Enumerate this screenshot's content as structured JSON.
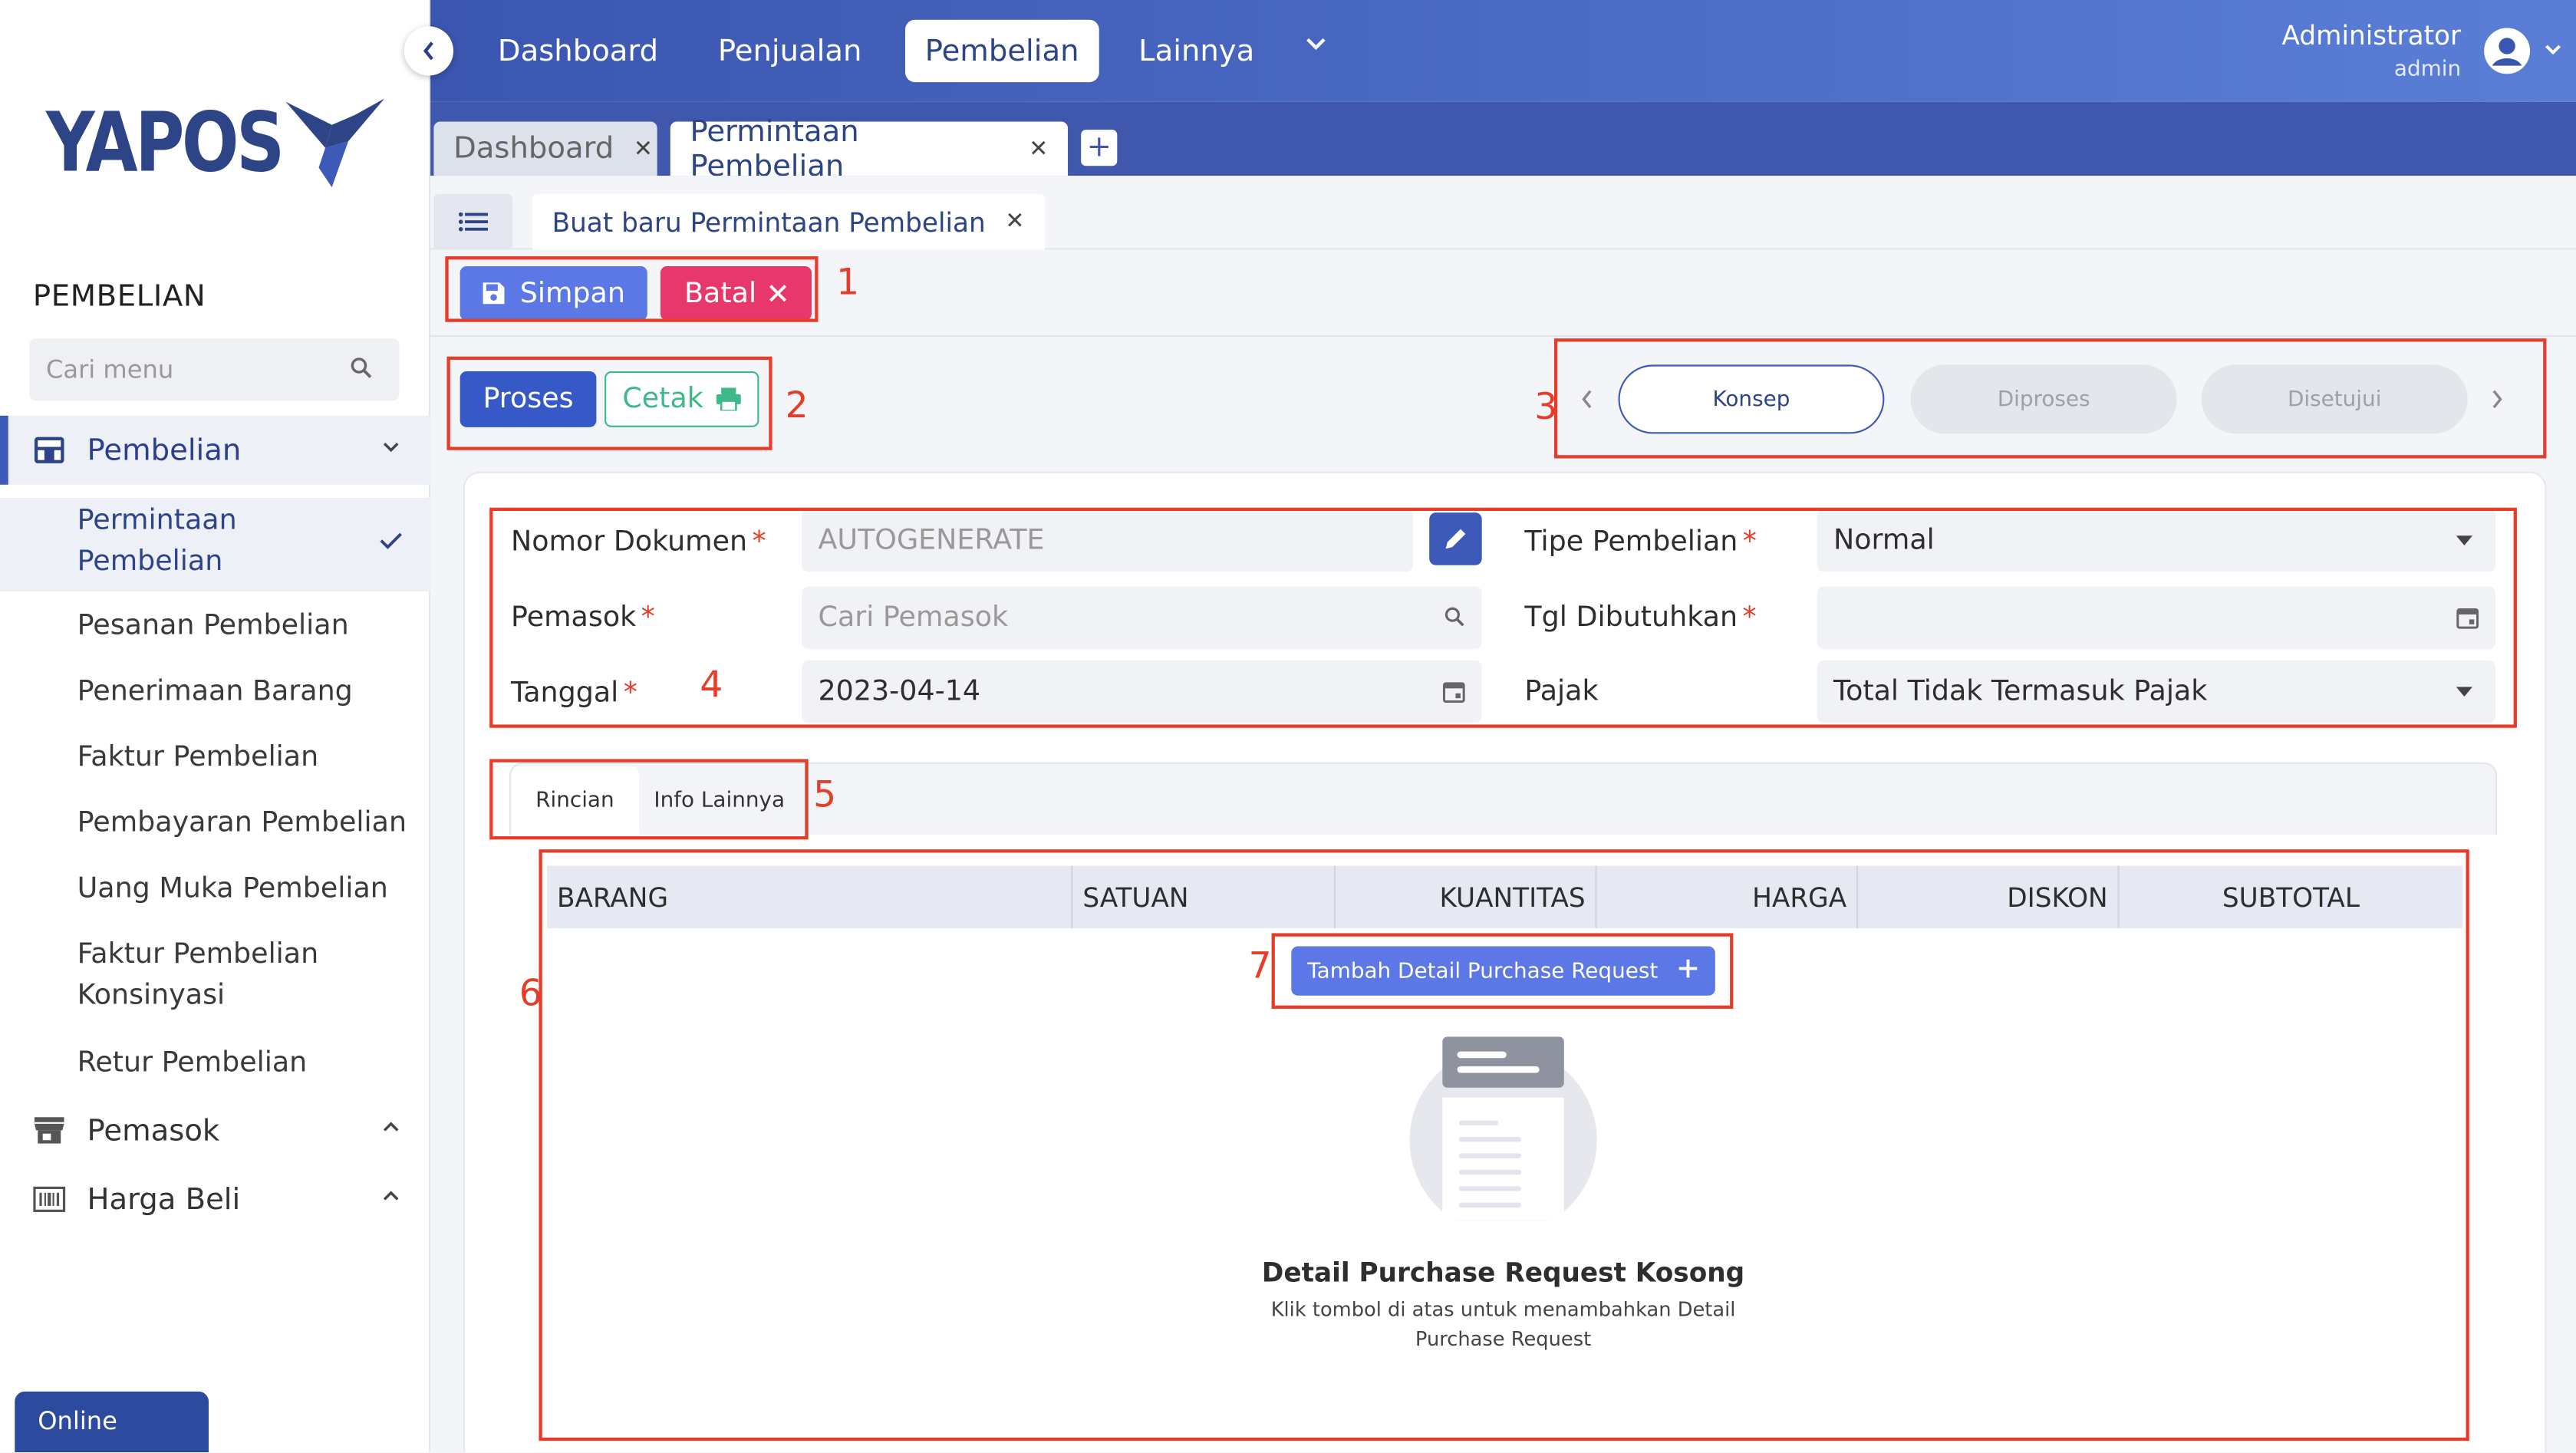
{
  "app": {
    "logo_text": "YAPOS"
  },
  "sidebar": {
    "section_title": "PEMBELIAN",
    "search_placeholder": "Cari menu",
    "groups": [
      {
        "label": "Pembelian",
        "icon": "inbox-icon",
        "expanded": true
      },
      {
        "label": "Pemasok",
        "icon": "store-icon",
        "expanded": false
      },
      {
        "label": "Harga Beli",
        "icon": "barcode-icon",
        "expanded": false
      }
    ],
    "items": [
      {
        "label": "Permintaan Pembelian",
        "active": true
      },
      {
        "label": "Pesanan Pembelian"
      },
      {
        "label": "Penerimaan Barang"
      },
      {
        "label": "Faktur Pembelian"
      },
      {
        "label": "Pembayaran Pembelian"
      },
      {
        "label": "Uang Muka Pembelian"
      },
      {
        "label": "Faktur Pembelian Konsinyasi"
      },
      {
        "label": "Retur Pembelian"
      }
    ],
    "status": "Online"
  },
  "topnav": {
    "items": [
      "Dashboard",
      "Penjualan",
      "Pembelian",
      "Lainnya"
    ],
    "active": "Pembelian",
    "user_name": "Administrator",
    "user_role": "admin"
  },
  "tabs": {
    "items": [
      {
        "label": "Dashboard",
        "active": false
      },
      {
        "label": "Permintaan Pembelian",
        "active": true
      }
    ],
    "add_label": "+"
  },
  "subtab": {
    "label": "Buat baru Permintaan Pembelian",
    "close": "×"
  },
  "actions": {
    "save": "Simpan",
    "cancel": "Batal",
    "process": "Proses",
    "print": "Cetak"
  },
  "status_steps": [
    "Konsep",
    "Diproses",
    "Disetujui"
  ],
  "form": {
    "doc_number_label": "Nomor Dokumen",
    "doc_number_value": "AUTOGENERATE",
    "supplier_label": "Pemasok",
    "supplier_placeholder": "Cari Pemasok",
    "date_label": "Tanggal",
    "date_value": "2023-04-14",
    "purchase_type_label": "Tipe Pembelian",
    "purchase_type_value": "Normal",
    "needed_date_label": "Tgl Dibutuhkan",
    "needed_date_value": "",
    "tax_label": "Pajak",
    "tax_value": "Total Tidak Termasuk Pajak",
    "required_mark": "*"
  },
  "inner_tabs": [
    "Rincian",
    "Info Lainnya"
  ],
  "table": {
    "columns": [
      "BARANG",
      "SATUAN",
      "KUANTITAS",
      "HARGA",
      "DISKON",
      "SUBTOTAL"
    ],
    "add_button": "Tambah Detail Purchase Request",
    "empty_title": "Detail Purchase Request Kosong",
    "empty_desc": "Klik tombol di atas untuk menambahkan Detail Purchase Request"
  },
  "annotations": [
    "1",
    "2",
    "3",
    "4",
    "5",
    "6",
    "7"
  ],
  "colors": {
    "primary": "#3758c7",
    "danger": "#e8376b",
    "success": "#3fb88a",
    "annotation": "#e53d2a"
  }
}
